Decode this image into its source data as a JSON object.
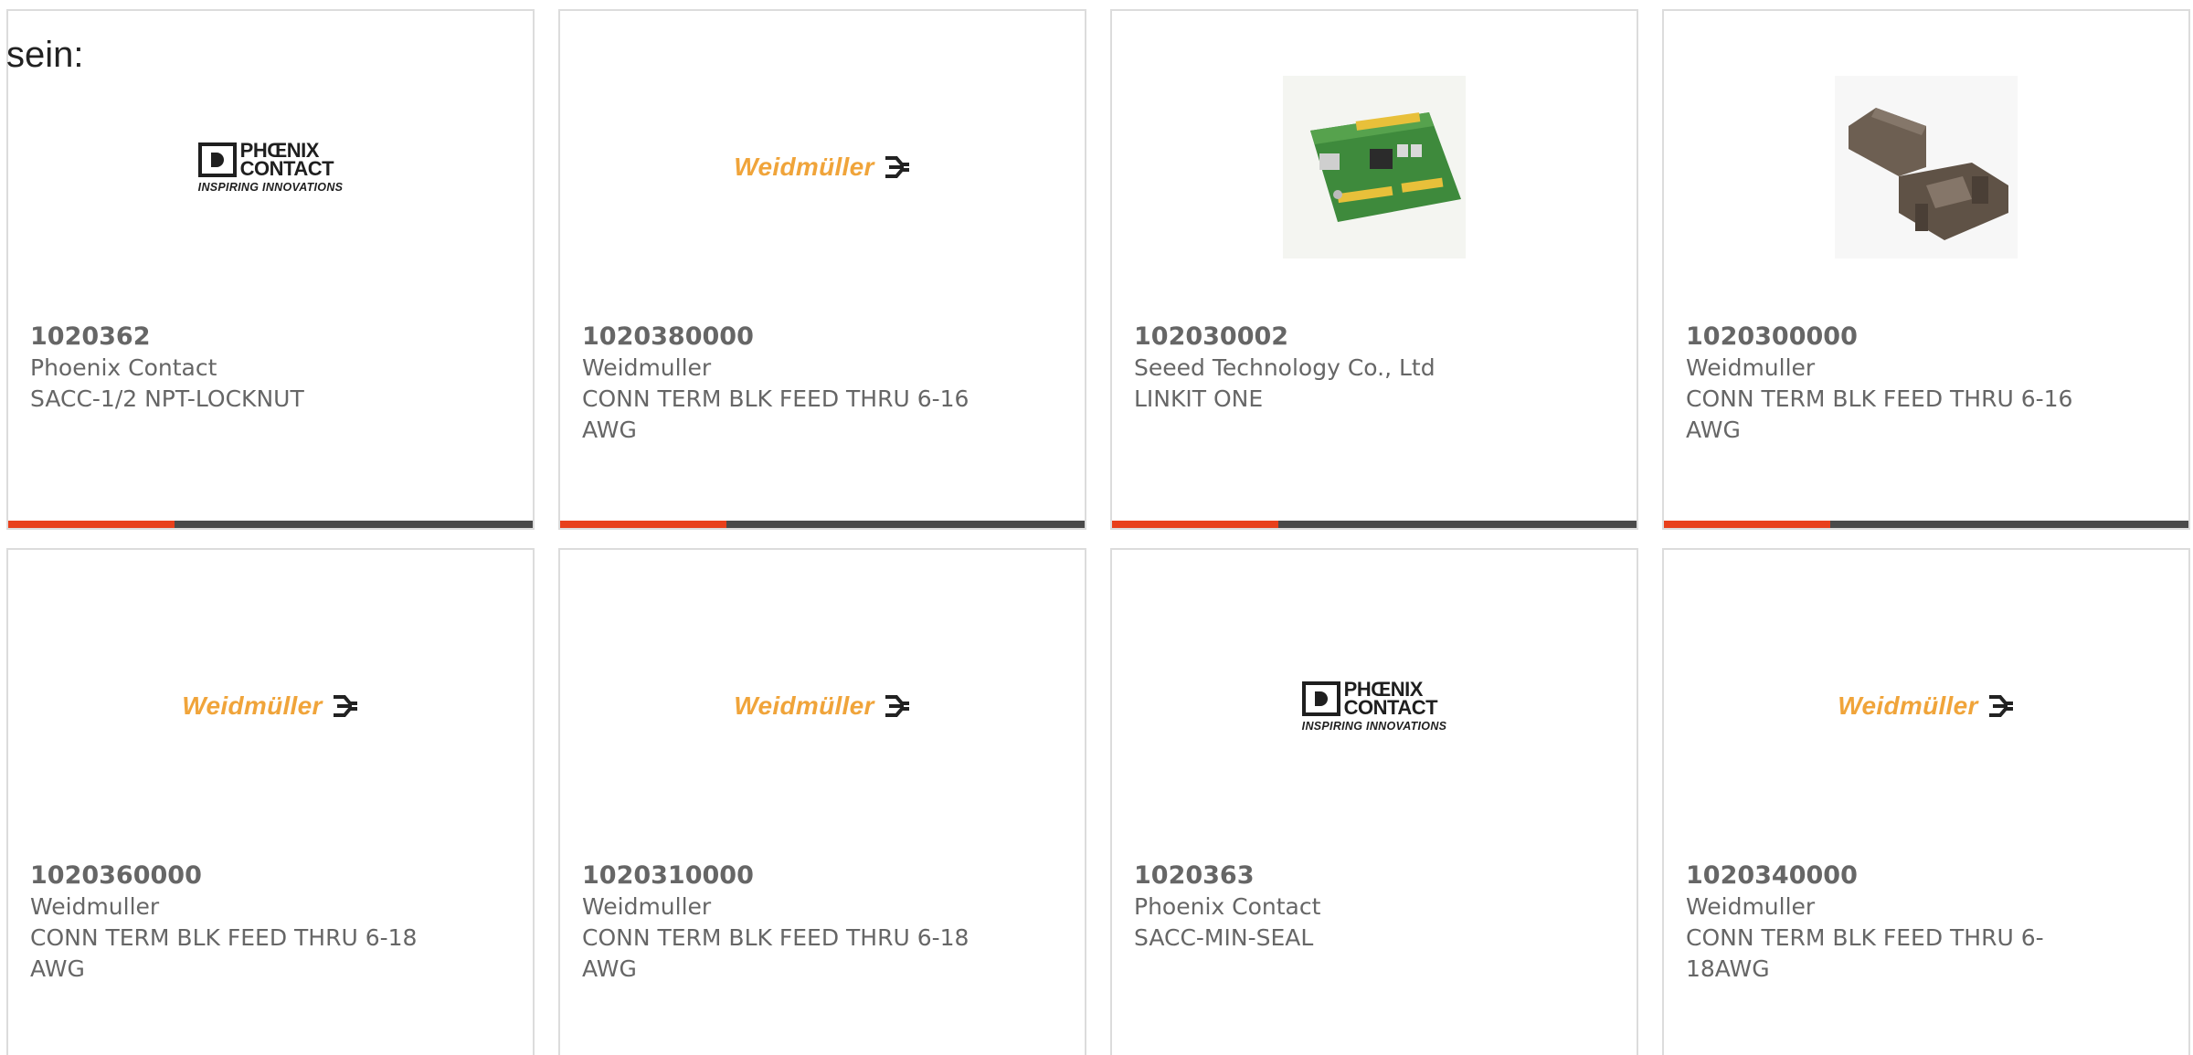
{
  "lead_text": "sein:",
  "colors": {
    "accent_bar": "#e8401c",
    "bar_dark": "#4a4a4a",
    "weidmuller_orange": "#f0a43a",
    "text_gray": "#666666"
  },
  "products": [
    {
      "part_number": "1020362",
      "manufacturer": "Phoenix Contact",
      "description": "SACC-1/2 NPT-LOCKNUT",
      "image": "phoenix-contact-logo"
    },
    {
      "part_number": "1020380000",
      "manufacturer": "Weidmuller",
      "description": "CONN TERM BLK FEED THRU 6-16 AWG",
      "image": "weidmuller-logo"
    },
    {
      "part_number": "102030002",
      "manufacturer": "Seeed Technology Co., Ltd",
      "description": "LINKIT ONE",
      "image": "circuit-board-photo"
    },
    {
      "part_number": "1020300000",
      "manufacturer": "Weidmuller",
      "description": "CONN TERM BLK FEED THRU 6-16 AWG",
      "image": "terminal-block-photo"
    },
    {
      "part_number": "1020360000",
      "manufacturer": "Weidmuller",
      "description": "CONN TERM BLK FEED THRU 6-18 AWG",
      "image": "weidmuller-logo"
    },
    {
      "part_number": "1020310000",
      "manufacturer": "Weidmuller",
      "description": "CONN TERM BLK FEED THRU 6-18 AWG",
      "image": "weidmuller-logo"
    },
    {
      "part_number": "1020363",
      "manufacturer": "Phoenix Contact",
      "description": "SACC-MIN-SEAL",
      "image": "phoenix-contact-logo"
    },
    {
      "part_number": "1020340000",
      "manufacturer": "Weidmuller",
      "description": "CONN TERM BLK FEED THRU 6-18AWG",
      "image": "weidmuller-logo"
    }
  ],
  "logos": {
    "phoenix_line1": "PHŒNIX",
    "phoenix_line2": "CONTACT",
    "phoenix_tagline": "INSPIRING INNOVATIONS",
    "weidmuller_wordmark": "Weidmüller"
  }
}
